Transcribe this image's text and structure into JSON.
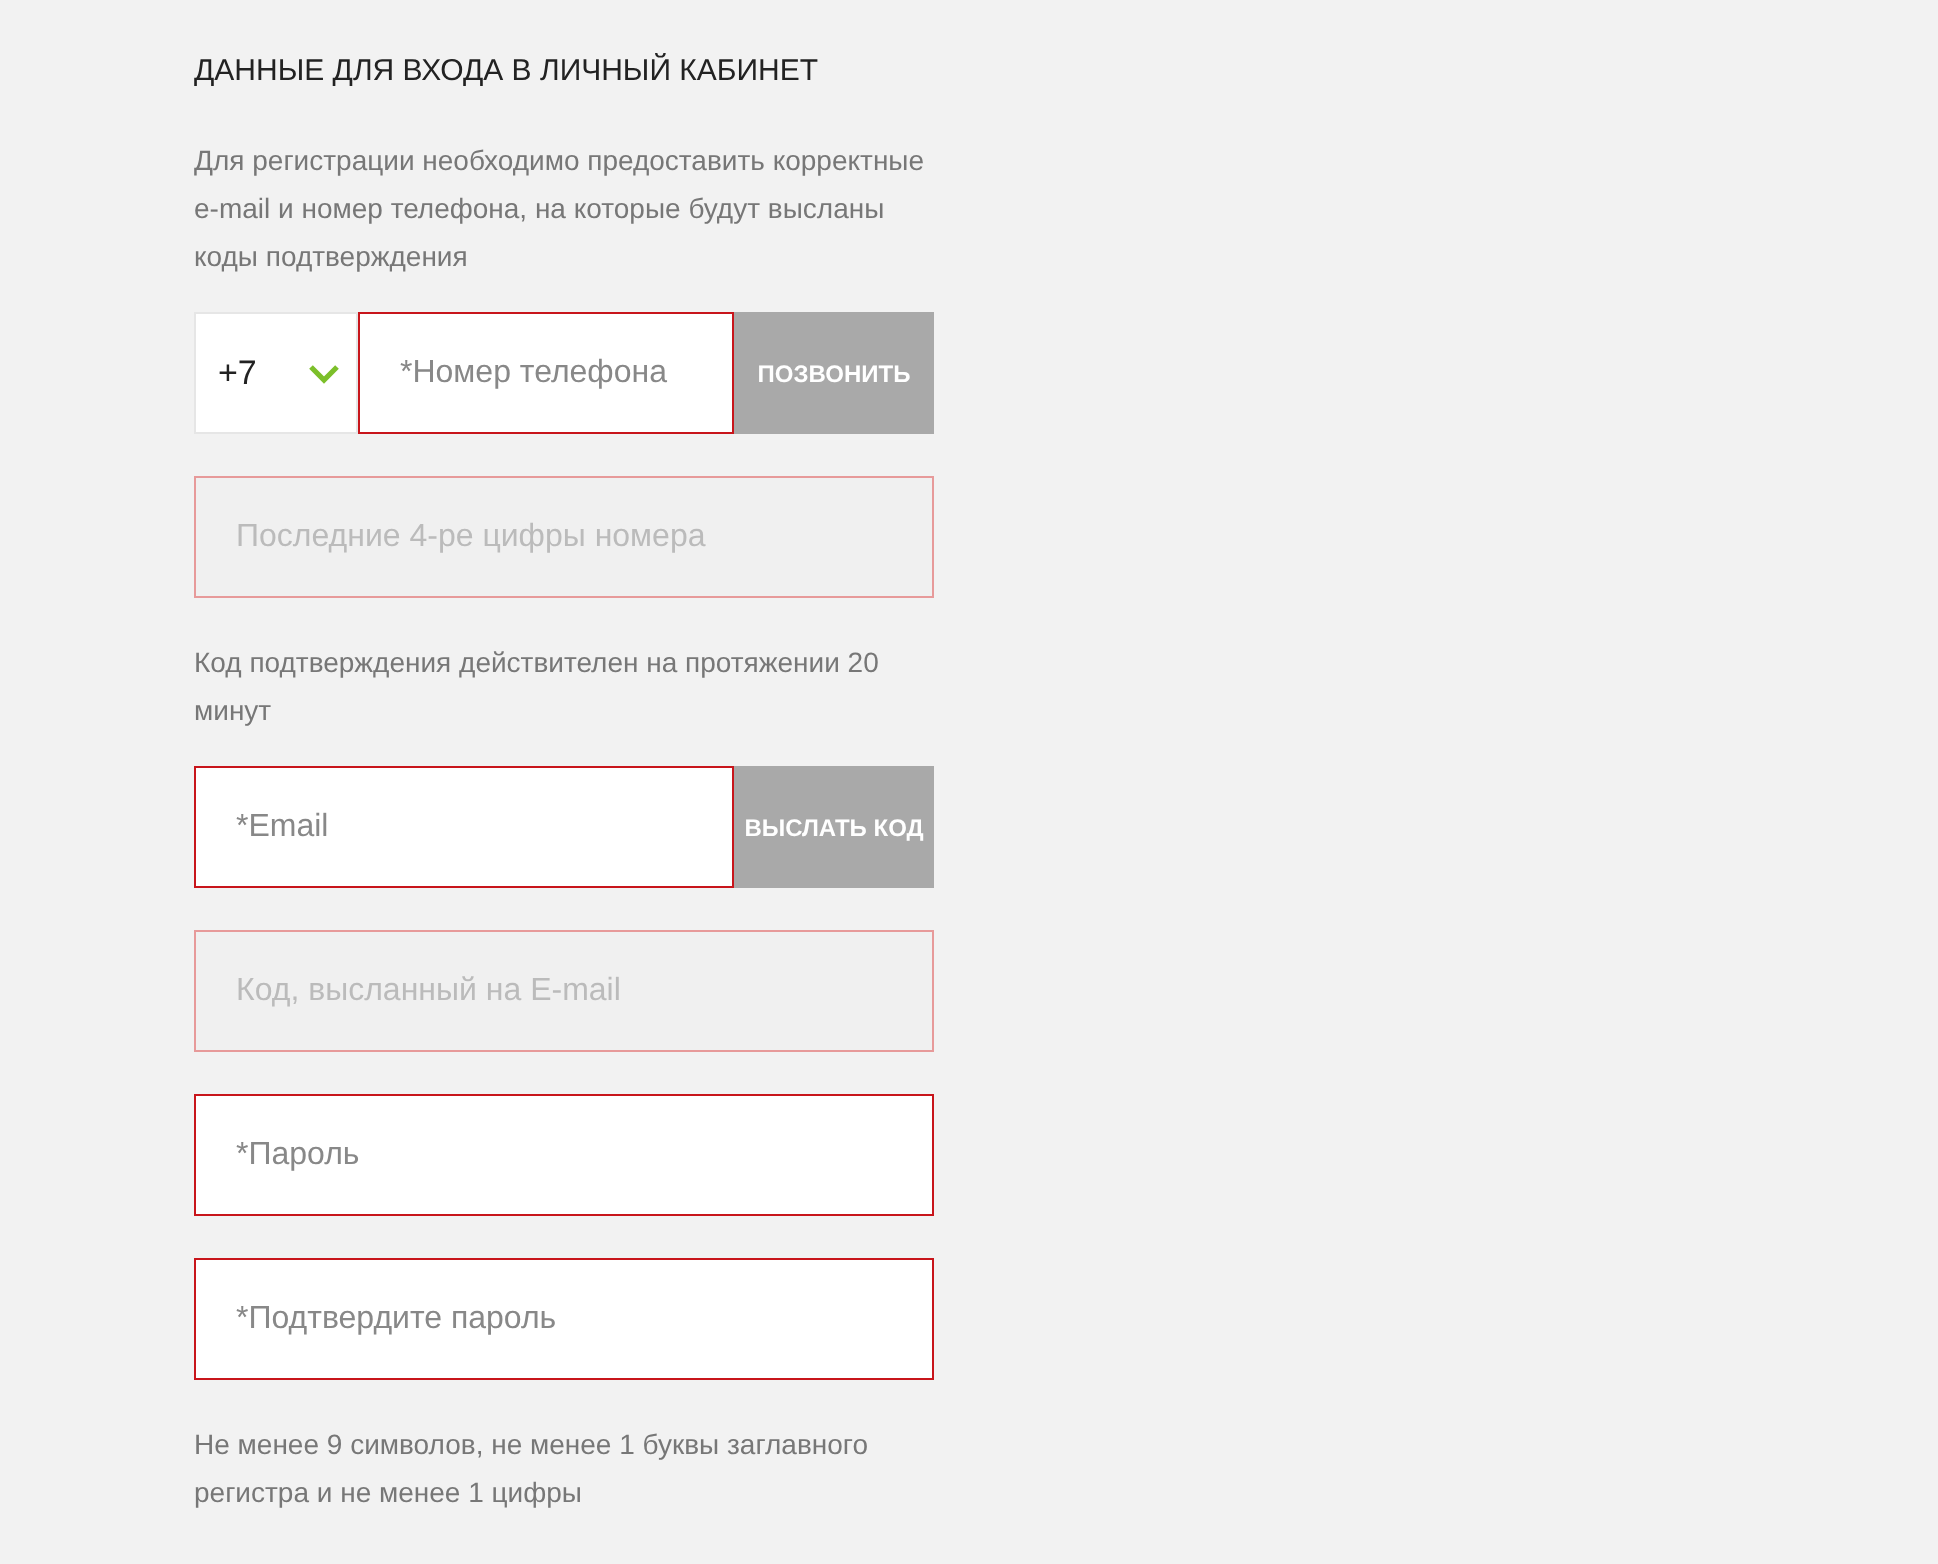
{
  "title": "ДАННЫЕ ДЛЯ ВХОДА В ЛИЧНЫЙ КАБИНЕТ",
  "items": [
    {
      "kind": "note",
      "text": "Для регистрации необходимо предоставить корректные e-mail и номер телефона, на которые будут высланы коды подтверждения"
    },
    {
      "kind": "phone",
      "prefix": "+7",
      "placeholder": "*Номер телефона",
      "button": "ПОЗВОНИТЬ"
    },
    {
      "kind": "field",
      "placeholder": "Последние 4-ре цифры номера",
      "disabled": true
    },
    {
      "kind": "note",
      "text": "Код подтверждения действителен на протяжении 20 минут"
    },
    {
      "kind": "field_button",
      "placeholder": "*Email",
      "button": "ВЫСЛАТЬ КОД"
    },
    {
      "kind": "field",
      "placeholder": "Код, высланный на E-mail",
      "disabled": true
    },
    {
      "kind": "field",
      "placeholder": "*Пароль",
      "disabled": false
    },
    {
      "kind": "field",
      "placeholder": "*Подтвердите пароль",
      "disabled": false
    },
    {
      "kind": "note",
      "text": "Не менее 9 символов, не менее 1 буквы заглавного регистра и не менее 1 цифры"
    }
  ]
}
